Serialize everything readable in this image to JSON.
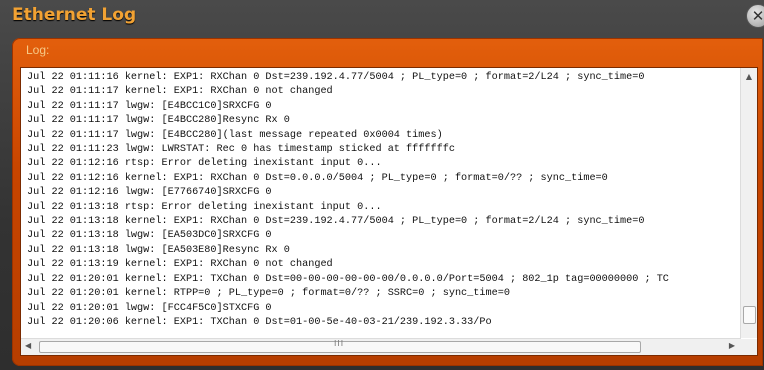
{
  "window": {
    "title": "Ethernet Log",
    "close_icon": "close-icon"
  },
  "panel": {
    "label": "Log:"
  },
  "log": {
    "lines": [
      "Jul 22 01:11:16 kernel: EXP1: RXChan 0 Dst=239.192.4.77/5004 ; PL_type=0 ; format=2/L24 ; sync_time=0",
      "Jul 22 01:11:17 kernel: EXP1: RXChan 0 not changed",
      "Jul 22 01:11:17 lwgw: [E4BCC1C0]SRXCFG 0",
      "Jul 22 01:11:17 lwgw: [E4BCC280]Resync Rx 0",
      "Jul 22 01:11:17 lwgw: [E4BCC280](last message repeated 0x0004 times)",
      "Jul 22 01:11:23 lwgw: LWRSTAT: Rec 0 has timestamp sticked at fffffffc",
      "Jul 22 01:12:16 rtsp: Error deleting inexistant input 0...",
      "Jul 22 01:12:16 kernel: EXP1: RXChan 0 Dst=0.0.0.0/5004 ; PL_type=0 ; format=0/?? ; sync_time=0",
      "Jul 22 01:12:16 lwgw: [E7766740]SRXCFG 0",
      "Jul 22 01:13:18 rtsp: Error deleting inexistant input 0...",
      "Jul 22 01:13:18 kernel: EXP1: RXChan 0 Dst=239.192.4.77/5004 ; PL_type=0 ; format=2/L24 ; sync_time=0",
      "Jul 22 01:13:18 lwgw: [EA503DC0]SRXCFG 0",
      "Jul 22 01:13:18 lwgw: [EA503E80]Resync Rx 0",
      "Jul 22 01:13:19 kernel: EXP1: RXChan 0 not changed",
      "Jul 22 01:20:01 kernel: EXP1: TXChan 0 Dst=00-00-00-00-00-00/0.0.0.0/Port=5004 ; 802_1p tag=00000000 ; TC",
      "Jul 22 01:20:01 kernel: RTPP=0 ; PL_type=0 ; format=0/?? ; SSRC=0 ; sync_time=0",
      "Jul 22 01:20:01 lwgw: [FCC4F5C0]STXCFG 0",
      "Jul 22 01:20:06 kernel: EXP1: TXChan 0 Dst=01-00-5e-40-03-21/239.192.3.33/Po"
    ]
  },
  "scrollbar": {
    "grip": "III"
  },
  "colors": {
    "title": "#f2a233",
    "panel": "#c84500",
    "background": "#3a3a3a"
  }
}
